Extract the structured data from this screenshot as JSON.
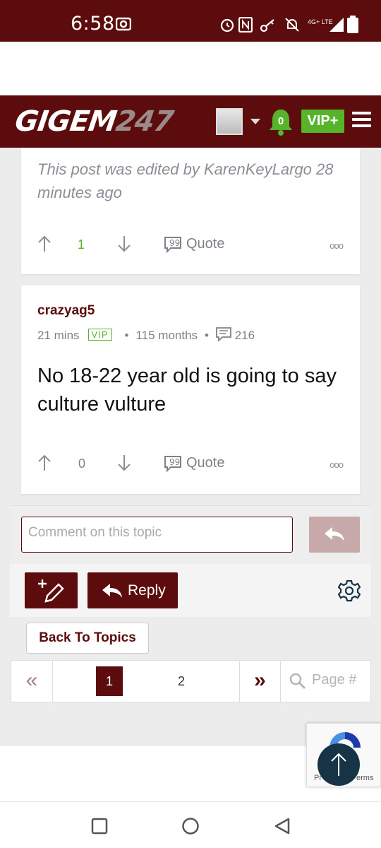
{
  "status_bar": {
    "time": "6:58",
    "network": "4G+ LTE"
  },
  "header": {
    "logo_text": "GIGEM",
    "logo_number": "247",
    "notification_count": "0",
    "vip_label": "VIP+"
  },
  "post1": {
    "edited_note": "This post was edited by KarenKeyLargo 28 minutes ago",
    "upvotes": "1",
    "quote_label": "Quote"
  },
  "post2": {
    "username": "crazyag5",
    "time_ago": "21 mins",
    "badge": "VIP",
    "tenure": "115 months",
    "post_count": "216",
    "body": "No 18-22 year old is going to say culture vulture",
    "upvotes": "0",
    "quote_label": "Quote"
  },
  "comment": {
    "placeholder": "Comment on this topic"
  },
  "toolbar": {
    "reply_label": "Reply"
  },
  "back_label": "Back To Topics",
  "pagination": {
    "pages": [
      "1",
      "2"
    ],
    "current": "1",
    "page_input_placeholder": "Page #"
  },
  "recaptcha": {
    "privacy": "Pr",
    "terms": "erms"
  },
  "colors": {
    "brand": "#5c0c0c",
    "vip_green": "#56b32a",
    "muted": "#8a8f96"
  }
}
